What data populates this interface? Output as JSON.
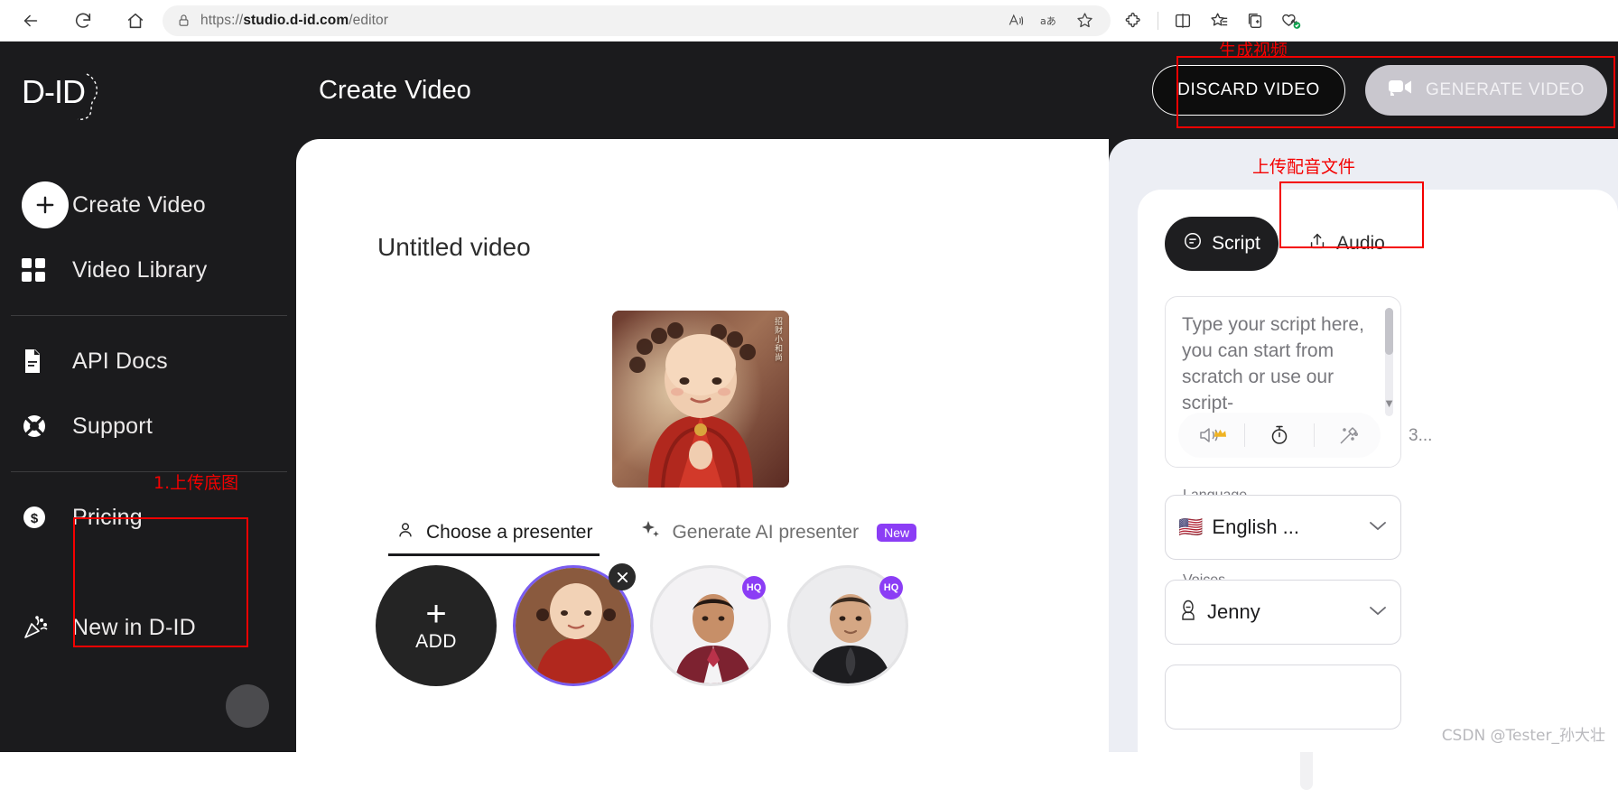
{
  "browser": {
    "url_prefix": "https://",
    "url_domain": "studio.d-id.com",
    "url_path": "/editor",
    "back_icon": "back-arrow-icon",
    "reload_icon": "reload-icon",
    "home_icon": "home-icon",
    "lock_icon": "lock-icon",
    "read_aloud_icon": "read-aloud-icon",
    "translate_icon": "translate-icon",
    "favorite_icon": "star-icon",
    "extensions_icon": "extensions-puzzle-icon",
    "split_screen_icon": "split-screen-icon",
    "collections_icon": "collections-icon",
    "add_tab_icon": "add-to-tabs-icon",
    "browser_essentials_icon": "browser-essentials-icon"
  },
  "sidebar": {
    "logo_text": "D-ID",
    "items": [
      {
        "label": "Create Video",
        "icon": "plus-circle-icon"
      },
      {
        "label": "Video Library",
        "icon": "grid-icon"
      },
      {
        "label": "API Docs",
        "icon": "document-icon"
      },
      {
        "label": "Support",
        "icon": "lifebuoy-icon"
      },
      {
        "label": "Pricing",
        "icon": "dollar-circle-icon"
      },
      {
        "label": "New in D-ID",
        "icon": "party-popper-icon"
      }
    ]
  },
  "header": {
    "title": "Create Video",
    "discard_label": "DISCARD VIDEO",
    "generate_label": "GENERATE VIDEO",
    "generate_icon": "video-camera-icon"
  },
  "canvas": {
    "video_title": "Untitled video",
    "preview_side_text": "招财小和尚"
  },
  "presenter_tabs": [
    {
      "label": "Choose a presenter",
      "icon": "person-icon",
      "active": true,
      "badge": ""
    },
    {
      "label": "Generate AI presenter",
      "icon": "sparkle-icon",
      "active": false,
      "badge": "New"
    }
  ],
  "presenters": {
    "add_label": "ADD",
    "add_plus": "+",
    "items": [
      {
        "name": "baby-monk-presenter",
        "selected": true,
        "hq": "",
        "removable": true
      },
      {
        "name": "man-maroon-suit-presenter",
        "selected": false,
        "hq": "HQ",
        "removable": false
      },
      {
        "name": "man-black-suit-presenter",
        "selected": false,
        "hq": "HQ",
        "removable": false
      }
    ]
  },
  "right_panel": {
    "tabs": [
      {
        "label": "Script",
        "icon": "speech-bubble-icon",
        "active": true
      },
      {
        "label": "Audio",
        "icon": "upload-icon",
        "active": false
      }
    ],
    "script_placeholder": "Type your script here, you can start from scratch or use our script-",
    "char_count": "3...",
    "tools": [
      {
        "name": "speaker-premium-icon",
        "badge": "crown"
      },
      {
        "name": "timer-icon",
        "badge": ""
      },
      {
        "name": "magic-wand-icon",
        "badge": ""
      }
    ],
    "language": {
      "legend": "Language",
      "flag": "🇺🇸",
      "value": "English ...",
      "chevron": "chevron-down-icon"
    },
    "voices": {
      "legend": "Voices",
      "icon": "voice-person-icon",
      "value": "Jenny",
      "chevron": "chevron-down-icon"
    }
  },
  "annotations": [
    {
      "id": "generate-video-note",
      "text": "生成视频"
    },
    {
      "id": "upload-audio-note",
      "text": "上传配音文件"
    },
    {
      "id": "upload-base-image-note",
      "text": "1.上传底图"
    }
  ],
  "watermark": "CSDN @Tester_孙大壮"
}
